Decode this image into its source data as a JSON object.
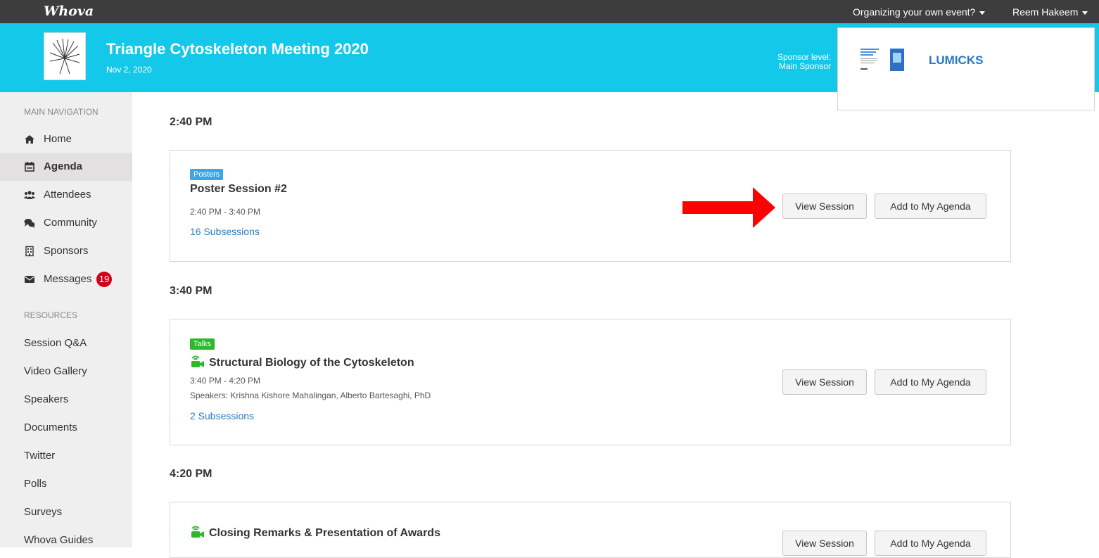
{
  "topbar": {
    "logo": "Whova",
    "organizing_link": "Organizing your own event?",
    "user_name": "Reem Hakeem"
  },
  "event": {
    "title": "Triangle Cytoskeleton Meeting 2020",
    "date": "Nov 2, 2020",
    "sponsor_level_label": "Sponsor level:",
    "sponsor_level_value": "Main Sponsor",
    "sponsor_name": "LUMICKS"
  },
  "sidebar": {
    "main_heading": "MAIN NAVIGATION",
    "main_items": [
      {
        "label": "Home",
        "icon": "home-icon"
      },
      {
        "label": "Agenda",
        "icon": "calendar-icon",
        "active": true
      },
      {
        "label": "Attendees",
        "icon": "users-icon"
      },
      {
        "label": "Community",
        "icon": "chat-icon"
      },
      {
        "label": "Sponsors",
        "icon": "building-icon"
      },
      {
        "label": "Messages",
        "icon": "envelope-icon",
        "badge": "19"
      }
    ],
    "resources_heading": "RESOURCES",
    "resource_items": [
      "Session Q&A",
      "Video Gallery",
      "Speakers",
      "Documents",
      "Twitter",
      "Polls",
      "Surveys",
      "Whova Guides"
    ]
  },
  "agenda": {
    "view_label": "View Session",
    "add_label": "Add to My Agenda",
    "slots": [
      {
        "time": "2:40 PM",
        "tag": "Posters",
        "title": "Poster Session #2",
        "time_range": "2:40 PM - 3:40 PM",
        "subsessions": "16 Subsessions"
      },
      {
        "time": "3:40 PM",
        "tag": "Talks",
        "title": "Structural Biology of the Cytoskeleton",
        "time_range": "3:40 PM - 4:20 PM",
        "speakers": "Speakers: Krishna Kishore Mahalingan, Alberto Bartesaghi, PhD",
        "subsessions": "2 Subsessions"
      },
      {
        "time": "4:20 PM",
        "title": "Closing Remarks & Presentation of Awards"
      }
    ]
  },
  "colors": {
    "banner": "#13c8e8",
    "topbar": "#3d3d3d",
    "link": "#2a7bc2",
    "badge": "#d0021b",
    "posters_tag": "#3aa6e8",
    "talks_tag": "#2db82d",
    "annotation_arrow": "#ff0000"
  }
}
